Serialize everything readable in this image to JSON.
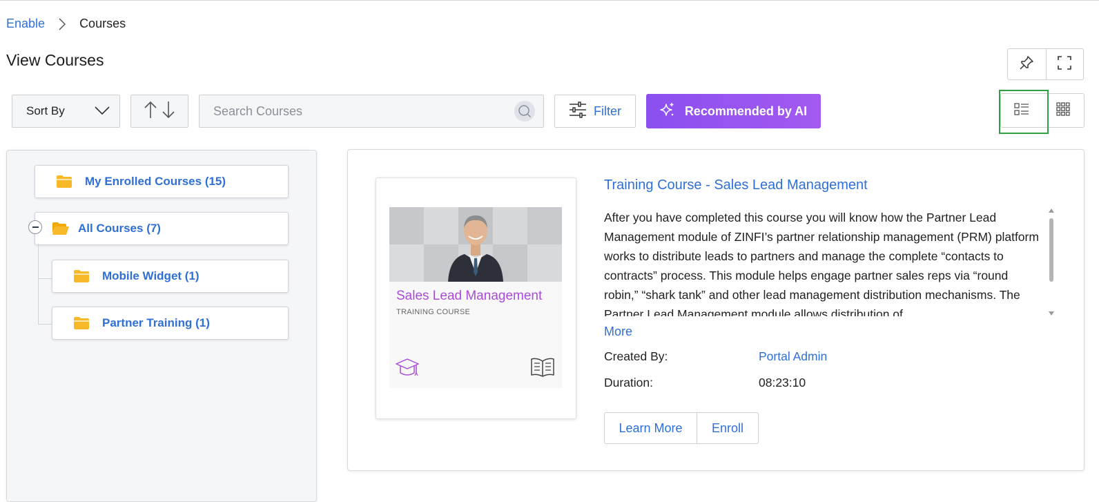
{
  "breadcrumb": {
    "root": "Enable",
    "current": "Courses"
  },
  "page": {
    "title": "View Courses"
  },
  "toolbar": {
    "sort_label": "Sort By",
    "search_placeholder": "Search Courses",
    "filter_label": "Filter",
    "ai_label": "Recommended by AI",
    "active_view": "list"
  },
  "tree": {
    "enrolled": "My Enrolled Courses (15)",
    "all": "All Courses (7)",
    "children": [
      "Mobile Widget (1)",
      "Partner Training (1)"
    ]
  },
  "course": {
    "thumb_title": "Sales Lead Management",
    "thumb_subtitle": "TRAINING COURSE",
    "title": "Training Course - Sales Lead Management",
    "description": "After you have completed this course you will know how the Partner Lead Management module of ZINFI’s partner relationship management (PRM) platform works to distribute leads to partners and manage the complete “contacts to contracts” process. This module helps engage partner sales reps via “round robin,” “shark tank” and other lead management distribution mechanisms. The Partner Lead Management module allows distribution of",
    "more_label": "More",
    "created_by_label": "Created By:",
    "created_by_value": "Portal Admin",
    "duration_label": "Duration:",
    "duration_value": "08:23:10",
    "learn_more_label": "Learn More",
    "enroll_label": "Enroll"
  },
  "colors": {
    "link": "#2f6fd6",
    "ai_button": "#9b55f0",
    "thumb_title": "#a94bd8",
    "folder": "#f7b928",
    "active_highlight": "#2ea043"
  }
}
